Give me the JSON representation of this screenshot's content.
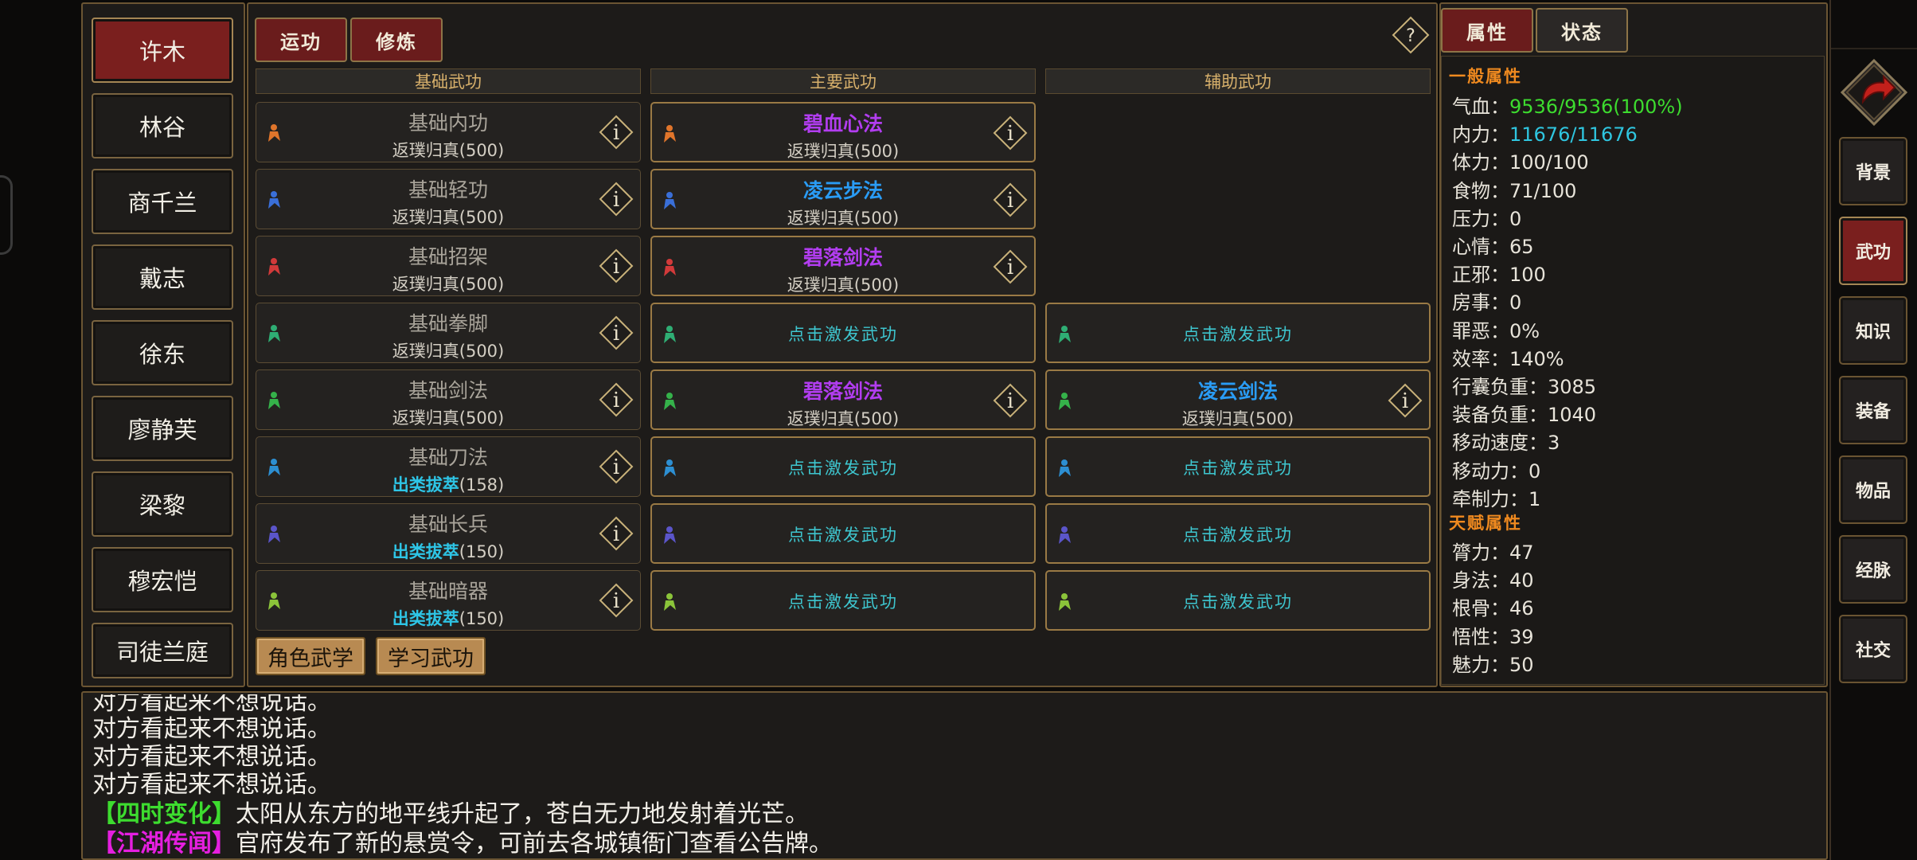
{
  "characters": [
    "许木",
    "林谷",
    "商千兰",
    "戴志",
    "徐东",
    "廖静芙",
    "梁黎",
    "穆宏恺",
    "司徒兰庭"
  ],
  "top_tabs": [
    "运功",
    "修炼"
  ],
  "help_label": "?",
  "right_tabs": [
    "属性",
    "状态"
  ],
  "columns": [
    "基础武功",
    "主要武功",
    "辅助武功"
  ],
  "activate_text": "点击激发武功",
  "info_glyph": "i",
  "basic_skills": [
    {
      "name": "基础内功",
      "level": "返璞归真",
      "value": "(500)"
    },
    {
      "name": "基础轻功",
      "level": "返璞归真",
      "value": "(500)"
    },
    {
      "name": "基础招架",
      "level": "返璞归真",
      "value": "(500)"
    },
    {
      "name": "基础拳脚",
      "level": "返璞归真",
      "value": "(500)"
    },
    {
      "name": "基础剑法",
      "level": "返璞归真",
      "value": "(500)"
    },
    {
      "name": "基础刀法",
      "level": "出类拔萃",
      "value": "(158)"
    },
    {
      "name": "基础长兵",
      "level": "出类拔萃",
      "value": "(150)"
    },
    {
      "name": "基础暗器",
      "level": "出类拔萃",
      "value": "(150)"
    }
  ],
  "main_skills": [
    {
      "name": "碧血心法",
      "level": "返璞归真",
      "value": "(500)"
    },
    {
      "name": "凌云步法",
      "level": "返璞归真",
      "value": "(500)"
    },
    {
      "name": "碧落剑法",
      "level": "返璞归真",
      "value": "(500)"
    },
    {
      "name": "",
      "level": "",
      "value": ""
    },
    {
      "name": "碧落剑法",
      "level": "返璞归真",
      "value": "(500)"
    }
  ],
  "aux_skills": [
    {
      "name": "凌云剑法",
      "level": "返璞归真",
      "value": "(500)"
    }
  ],
  "bottom_buttons": [
    "角色武学",
    "学习武功"
  ],
  "attributes": {
    "general_title": "一般属性",
    "general": [
      {
        "label": "气血：",
        "value": "9536/9536(100%)"
      },
      {
        "label": "内力：",
        "value": "11676/11676"
      },
      {
        "label": "体力：",
        "value": "100/100"
      },
      {
        "label": "食物：",
        "value": "71/100"
      },
      {
        "label": "压力：",
        "value": "0"
      },
      {
        "label": "心情：",
        "value": "65"
      },
      {
        "label": "正邪：",
        "value": "100"
      },
      {
        "label": "房事：",
        "value": "0"
      },
      {
        "label": "罪恶：",
        "value": "0%"
      },
      {
        "label": "效率：",
        "value": "140%"
      },
      {
        "label": "行囊负重：",
        "value": "3085"
      },
      {
        "label": "装备负重：",
        "value": "1040"
      },
      {
        "label": "移动速度：",
        "value": "3"
      },
      {
        "label": "移动力：",
        "value": "0"
      },
      {
        "label": "牵制力：",
        "value": "1"
      }
    ],
    "talent_title": "天赋属性",
    "talent": [
      {
        "label": "膂力：",
        "value": "47"
      },
      {
        "label": "身法：",
        "value": "40"
      },
      {
        "label": "根骨：",
        "value": "46"
      },
      {
        "label": "悟性：",
        "value": "39"
      },
      {
        "label": "魅力：",
        "value": "50"
      }
    ]
  },
  "side_nav": [
    "背景",
    "武功",
    "知识",
    "装备",
    "物品",
    "经脉",
    "社交"
  ],
  "log": {
    "partial": "对方看起来不想说话。",
    "lines": [
      "对方看起来不想说话。",
      "对方看起来不想说话。",
      "对方看起来不想说话。"
    ],
    "event1": {
      "tag": "【四时变化】",
      "text": "太阳从东方的地平线升起了，苍白无力地发射着光芒。"
    },
    "event2": {
      "tag": "【江湖传闻】",
      "text": "官府发布了新的悬赏令，可前去各城镇衙门查看公告牌。"
    }
  },
  "colors": {
    "accent_red": "#7a1f1e",
    "frame_gold": "#8d7447",
    "skill_purple": "#b23df0",
    "skill_blue": "#2a9cf5",
    "level_cyan": "#2ec5e6",
    "event_green": "#3ddc2f",
    "event_magenta": "#e51fe0",
    "header_orange": "#f08a1f"
  },
  "icons": [
    "skill-icon",
    "info-diamond-icon",
    "help-diamond-icon",
    "return-arrow-icon"
  ]
}
